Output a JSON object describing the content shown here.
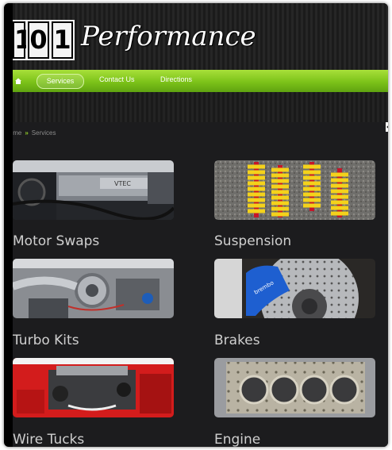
{
  "logo": {
    "digits": [
      "1",
      "0",
      "1"
    ],
    "word": "Performance"
  },
  "nav": {
    "home_icon": "home-icon",
    "items": [
      "Services",
      "Contact Us",
      "Directions"
    ]
  },
  "breadcrumb": {
    "home": "Home",
    "separator": "»",
    "current": "Services"
  },
  "services": [
    {
      "title": "Motor Swaps"
    },
    {
      "title": "Suspension"
    },
    {
      "title": "Turbo Kits"
    },
    {
      "title": "Brakes"
    },
    {
      "title": "Wire Tucks"
    },
    {
      "title": "Engine"
    }
  ],
  "colors": {
    "accent": "#7cc219",
    "background": "#1c1c1e",
    "text": "#cfcfcf"
  }
}
